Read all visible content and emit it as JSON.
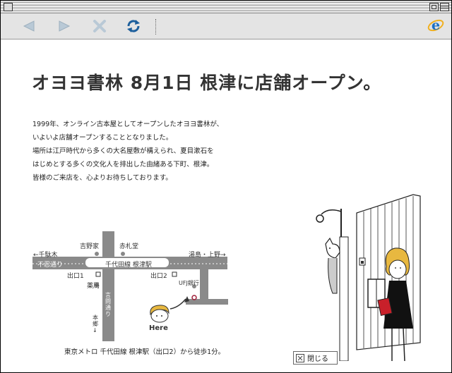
{
  "headline": "オヨヨ書林 8月1日 根津に店舗オープン。",
  "paragraph": [
    "1999年、オンライン古本屋としてオープンしたオヨヨ書林が、",
    "いよいよ店舗オープンすることとなりました。",
    "場所は江戸時代から多くの大名屋敷が構えられ、夏目漱石を",
    "はじめとする多くの文化人を排出した由緒ある下町、根津。",
    "皆様のご来店を、心よりお待ちしております。"
  ],
  "map": {
    "left_arrow": "←千駄木",
    "right_arrow": "湯島・上野→",
    "shinobazu": "不忍通り",
    "line_name": "千代田線 根津駅",
    "yoshinoya": "吉野家",
    "akafudado": "赤札堂",
    "exit1": "出口1",
    "exit2": "出口2",
    "yakkyoku": "薬局",
    "bank": "UFJ銀行",
    "kototoi": "言問通り",
    "hongo": "本郷↓",
    "here": "Here"
  },
  "footer_text": "東京メトロ 千代田線 根津駅（出口2）から徒歩1分。",
  "close_label": "閉じる",
  "toolbar": {
    "back": "back-icon",
    "forward": "forward-icon",
    "stop": "stop-icon",
    "refresh": "refresh-icon",
    "brand": "ie-logo-icon"
  }
}
